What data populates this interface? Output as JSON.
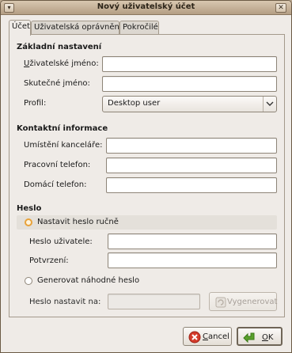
{
  "window": {
    "title": "Nový uživatelský účet",
    "menu_glyph": "▾",
    "close_glyph": "✕"
  },
  "tabs": [
    {
      "label": "Účet",
      "active": true
    },
    {
      "label": "Uživatelská oprávnění",
      "active": false
    },
    {
      "label": "Pokročilé",
      "active": false
    }
  ],
  "basic": {
    "title": "Základní nastavení",
    "username_label": "Uživatelské jméno:",
    "username_value": "",
    "realname_label": "Skutečné jméno:",
    "realname_value": "",
    "profile_label": "Profil:",
    "profile_value": "Desktop user"
  },
  "contact": {
    "title": "Kontaktní informace",
    "office_label": "Umístění kanceláře:",
    "office_value": "",
    "work_phone_label": "Pracovní telefon:",
    "work_phone_value": "",
    "home_phone_label": "Domácí telefon:",
    "home_phone_value": ""
  },
  "password": {
    "title": "Heslo",
    "manual_label": "Nastavit heslo ručně",
    "manual_selected": true,
    "user_password_label": "Heslo uživatele:",
    "confirm_label": "Potvrzení:",
    "random_label": "Generovat náhodné heslo",
    "random_selected": false,
    "set_to_label": "Heslo nastavit na:",
    "set_to_value": "",
    "generate_label": "Vygenerovat"
  },
  "buttons": {
    "cancel_label": "Cancel",
    "ok_label": "OK"
  },
  "colors": {
    "accent_radio": "#e8a23a",
    "cancel_icon": "#d43b2b",
    "ok_icon": "#5aa02c"
  }
}
